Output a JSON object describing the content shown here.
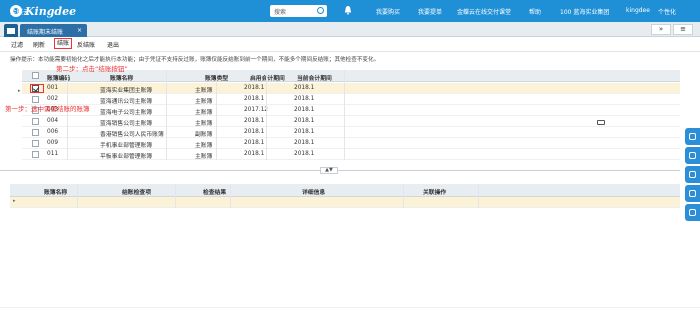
{
  "header": {
    "brand": "Kingdee",
    "brand_sub": "金蝶云",
    "search_placeholder": "搜索",
    "nav": [
      "我要购买",
      "我要提单",
      "金蝶云在线交付课堂",
      "帮助",
      "100 蓝海实业集团",
      "kingdee",
      "个性化"
    ]
  },
  "tabs": {
    "active_label": "结账期末结账",
    "close": "×"
  },
  "toolbar": {
    "buttons": [
      "过滤",
      "刷新",
      "结账",
      "反结账",
      "退出"
    ],
    "highlighted": "结账"
  },
  "hint": "操作提示：本功能需要初始化之后才能执行本功能；由于凭证不支持反过账，账簿仅能反结账到前一个期间，不能多个期间反结账；其他检查不变化。",
  "grid": {
    "columns": [
      "账簿编码",
      "账簿名称",
      "账簿类型",
      "启用会计期间",
      "当前会计期间"
    ],
    "rows": [
      {
        "code": "001",
        "name": "蓝海实业集团主账簿",
        "type": "主账簿",
        "start": "2018.1",
        "current": "2018.1",
        "checked": true
      },
      {
        "code": "002",
        "name": "蓝海通讯公司主账簿",
        "type": "主账簿",
        "start": "2018.1",
        "current": "2018.1",
        "checked": false
      },
      {
        "code": "003",
        "name": "蓝海电子公司主账簿",
        "type": "主账簿",
        "start": "2017.12",
        "current": "2018.1",
        "checked": false
      },
      {
        "code": "004",
        "name": "蓝海销售公司主账簿",
        "type": "主账簿",
        "start": "2018.1",
        "current": "2018.1",
        "checked": false
      },
      {
        "code": "006",
        "name": "香港销售公司人民币账簿",
        "type": "副账簿",
        "start": "2018.1",
        "current": "2018.1",
        "checked": false
      },
      {
        "code": "009",
        "name": "手机事业部管理账簿",
        "type": "主账簿",
        "start": "2018.1",
        "current": "2018.1",
        "checked": false
      },
      {
        "code": "011",
        "name": "平板事业部管理账簿",
        "type": "主账簿",
        "start": "2018.1",
        "current": "2018.1",
        "checked": false
      }
    ]
  },
  "annotations": {
    "step1": "第一步：选中需要结账的账簿",
    "step2": "第二步：点击“结账按钮”"
  },
  "panel": {
    "columns": [
      "账簿名称",
      "结账检查项",
      "检查结果",
      "详细信息",
      "关联操作"
    ]
  }
}
